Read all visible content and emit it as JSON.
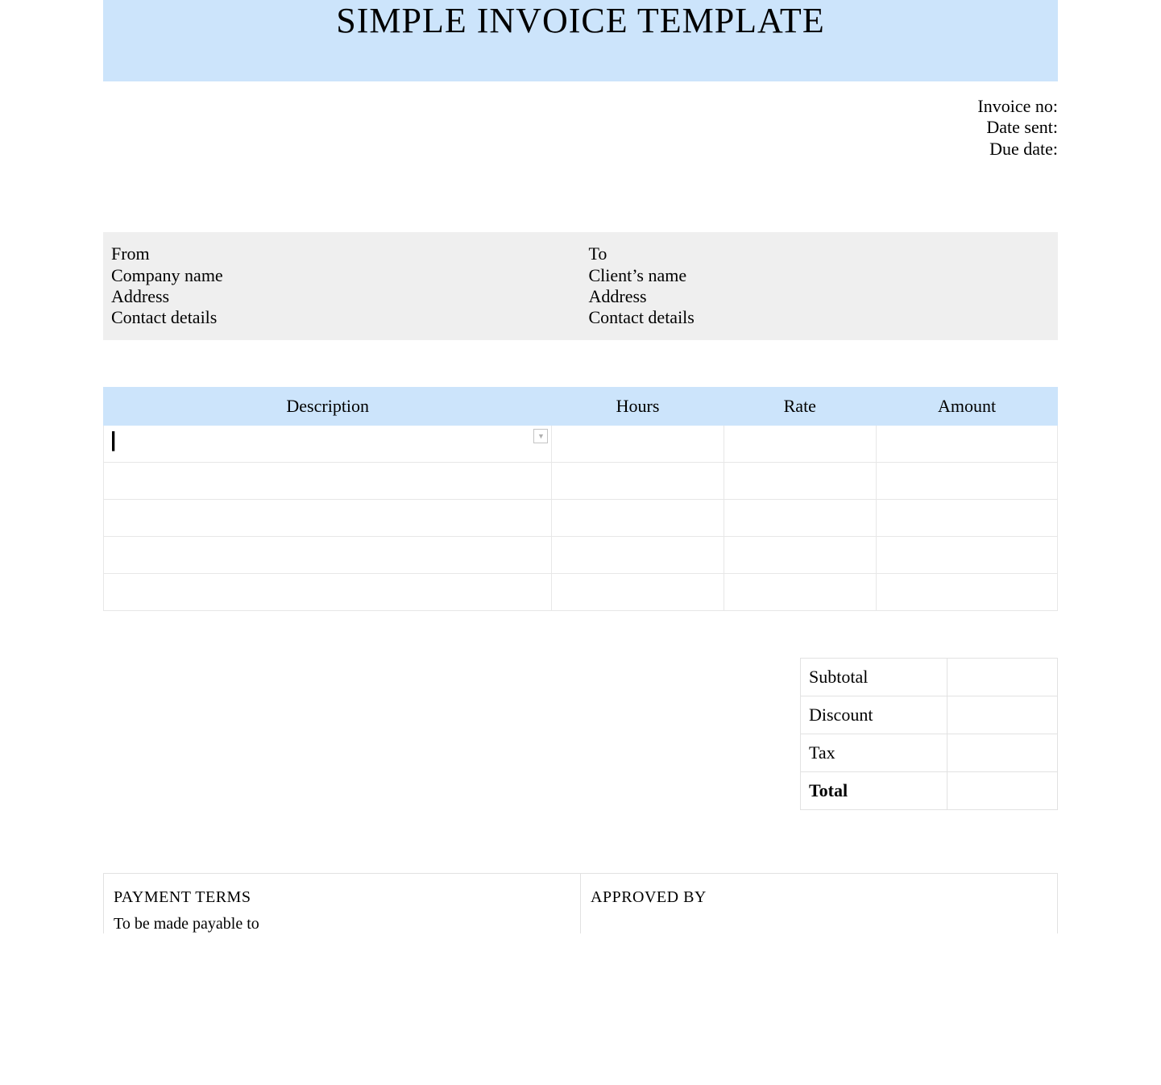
{
  "title": "SIMPLE INVOICE TEMPLATE",
  "meta": {
    "invoice_no_label": "Invoice no:",
    "date_sent_label": "Date sent:",
    "due_date_label": "Due date:"
  },
  "from": {
    "heading": "From",
    "company": "Company name",
    "address": "Address",
    "contact": "Contact details"
  },
  "to": {
    "heading": "To",
    "client": "Client’s name",
    "address": "Address",
    "contact": "Contact details"
  },
  "columns": {
    "description": "Description",
    "hours": "Hours",
    "rate": "Rate",
    "amount": "Amount"
  },
  "rows": [
    {
      "description": "",
      "hours": "",
      "rate": "",
      "amount": ""
    },
    {
      "description": "",
      "hours": "",
      "rate": "",
      "amount": ""
    },
    {
      "description": "",
      "hours": "",
      "rate": "",
      "amount": ""
    },
    {
      "description": "",
      "hours": "",
      "rate": "",
      "amount": ""
    },
    {
      "description": "",
      "hours": "",
      "rate": "",
      "amount": ""
    }
  ],
  "totals": {
    "subtotal_label": "Subtotal",
    "discount_label": "Discount",
    "tax_label": "Tax",
    "total_label": "Total",
    "subtotal": "",
    "discount": "",
    "tax": "",
    "total": ""
  },
  "footer": {
    "payment_terms_heading": "PAYMENT TERMS",
    "payment_terms_line": "To be made payable to",
    "approved_by_heading": "APPROVED BY"
  }
}
